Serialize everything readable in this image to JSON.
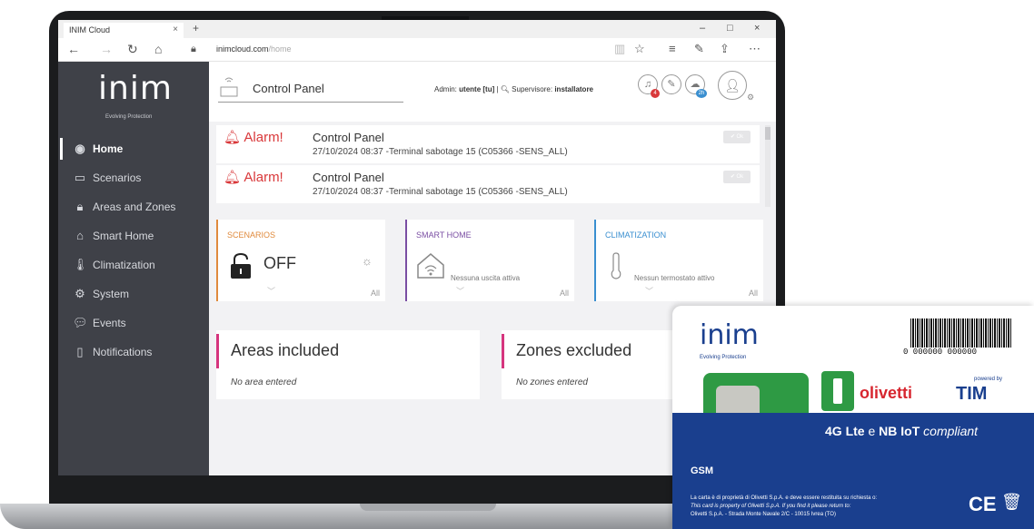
{
  "browser": {
    "tab_title": "INIM Cloud",
    "tab_close": "×",
    "new_tab": "+",
    "url_host": "inimcloud.com",
    "url_path": "/home",
    "win_minimize": "–",
    "win_maximize": "□",
    "win_close": "×"
  },
  "sidebar": {
    "logo": "inim",
    "logo_tagline": "Evolving Protection",
    "items": [
      {
        "label": "Home",
        "icon": "dashboard-icon",
        "glyph": "◉"
      },
      {
        "label": "Scenarios",
        "icon": "scenarios-icon",
        "glyph": "▭"
      },
      {
        "label": "Areas and Zones",
        "icon": "lock-icon",
        "glyph": "🔒︎"
      },
      {
        "label": "Smart Home",
        "icon": "smart-home-icon",
        "glyph": "⌂"
      },
      {
        "label": "Climatization",
        "icon": "thermometer-icon",
        "glyph": "🌡︎"
      },
      {
        "label": "System",
        "icon": "gears-icon",
        "glyph": "⚙"
      },
      {
        "label": "Events",
        "icon": "chat-icon",
        "glyph": "💬︎"
      },
      {
        "label": "Notifications",
        "icon": "phone-icon",
        "glyph": "▯"
      }
    ]
  },
  "topbar": {
    "title": "Control Panel",
    "admin_label": "Admin:",
    "admin_value": "utente [tu]",
    "supervisor_label": "Supervisore:",
    "supervisor_value": "installatore",
    "badge_alarm": "4",
    "badge_cloud": "2h"
  },
  "alarms": [
    {
      "label": "Alarm!",
      "title": "Control Panel",
      "desc": "27/10/2024 08:37 -Terminal sabotage 15  (C05366 -SENS_ALL)",
      "ok": "✔ Ok"
    },
    {
      "label": "Alarm!",
      "title": "Control Panel",
      "desc": "27/10/2024 08:37 -Terminal sabotage 15  (C05366 -SENS_ALL)",
      "ok": "✔ Ok"
    }
  ],
  "cards": {
    "scenarios": {
      "title": "SCENARIOS",
      "state": "OFF",
      "all": "All",
      "color": "#e08a3c"
    },
    "smart_home": {
      "title": "SMART HOME",
      "msg": "Nessuna uscita attiva",
      "all": "All",
      "color": "#7a4ea3"
    },
    "climatization": {
      "title": "CLIMATIZATION",
      "msg": "Nessun termostato attivo",
      "all": "All",
      "color": "#3a8fd0"
    }
  },
  "panels": {
    "areas": {
      "title": "Areas included",
      "msg": "No area entered"
    },
    "zones": {
      "title": "Zones excluded",
      "msg": "No zones entered"
    }
  },
  "sim": {
    "logo": "inim",
    "logo_tagline": "Evolving Protection",
    "barcode_number": "0 000000 000000",
    "olivetti": "olivetti",
    "tim_powered": "powered by",
    "tim": "TIM",
    "compliance_bold1": "4G Lte",
    "compliance_mid": " e ",
    "compliance_bold2": "NB IoT",
    "compliance_tail": " compliant",
    "gsm": "GSM",
    "legal_1": "La carta è di proprietà di Olivetti S.p.A. e deve essere restituita su richiesta o:",
    "legal_2": "This card is property of Olivetti S.p.A. If you find it please return to:",
    "legal_3": "Olivetti S.p.A. - Strada Monte Navale 2/C - 10015 Ivrea (TO)",
    "ce": "CE"
  }
}
